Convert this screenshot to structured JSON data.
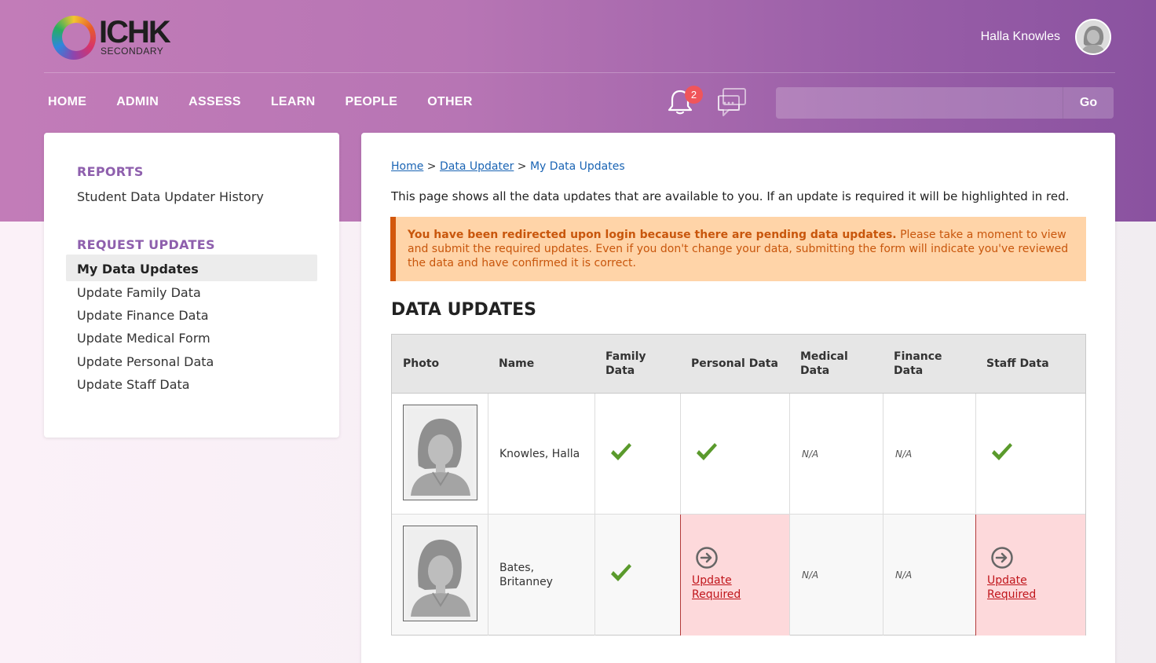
{
  "header": {
    "logo_text": "ICHK",
    "logo_sub": "SECONDARY",
    "user_name": "Halla Knowles",
    "notification_count": "2",
    "search_placeholder": "",
    "go_label": "Go"
  },
  "nav": {
    "items": [
      {
        "label": "HOME"
      },
      {
        "label": "ADMIN"
      },
      {
        "label": "ASSESS"
      },
      {
        "label": "LEARN"
      },
      {
        "label": "PEOPLE"
      },
      {
        "label": "OTHER"
      }
    ]
  },
  "sidebar": {
    "reports_heading": "REPORTS",
    "reports_link": "Student Data Updater History",
    "request_heading": "REQUEST UPDATES",
    "links": [
      {
        "label": "My Data Updates"
      },
      {
        "label": "Update Family Data"
      },
      {
        "label": "Update Finance Data"
      },
      {
        "label": "Update Medical Form"
      },
      {
        "label": "Update Personal Data"
      },
      {
        "label": "Update Staff Data"
      }
    ]
  },
  "main": {
    "breadcrumb": {
      "home": "Home",
      "sep1": ">",
      "data_updater": "Data Updater",
      "sep2": ">",
      "current": "My Data Updates"
    },
    "intro": "This page shows all the data updates that are available to you. If an update is required it will be highlighted in red.",
    "alert_bold": "You have been redirected upon login because there are pending data updates.",
    "alert_text": " Please take a moment to view and submit the required updates. Even if you don't change your data, submitting the form will indicate you've reviewed the data and have confirmed it is correct.",
    "section_title": "DATA UPDATES",
    "table": {
      "headers": {
        "photo": "Photo",
        "name": "Name",
        "family_1": "Family",
        "family_2": "Data",
        "personal": "Personal Data",
        "medical_1": "Medical",
        "medical_2": "Data",
        "finance_1": "Finance",
        "finance_2": "Data",
        "staff": "Staff Data"
      },
      "rows": [
        {
          "name_1": "Knowles, Halla",
          "name_2": "",
          "medical": "N/A",
          "finance": "N/A"
        },
        {
          "name_1": "Bates,",
          "name_2": "Britanney",
          "medical": "N/A",
          "finance": "N/A",
          "personal_update_1": "Update",
          "personal_update_2": "Required",
          "staff_update_1": "Update",
          "staff_update_2": "Required"
        }
      ]
    }
  },
  "colors": {
    "accent_purple": "#8e5fad",
    "alert_orange": "#d3580d",
    "required_red": "#c0151b",
    "check_green": "#5a9a2c"
  }
}
